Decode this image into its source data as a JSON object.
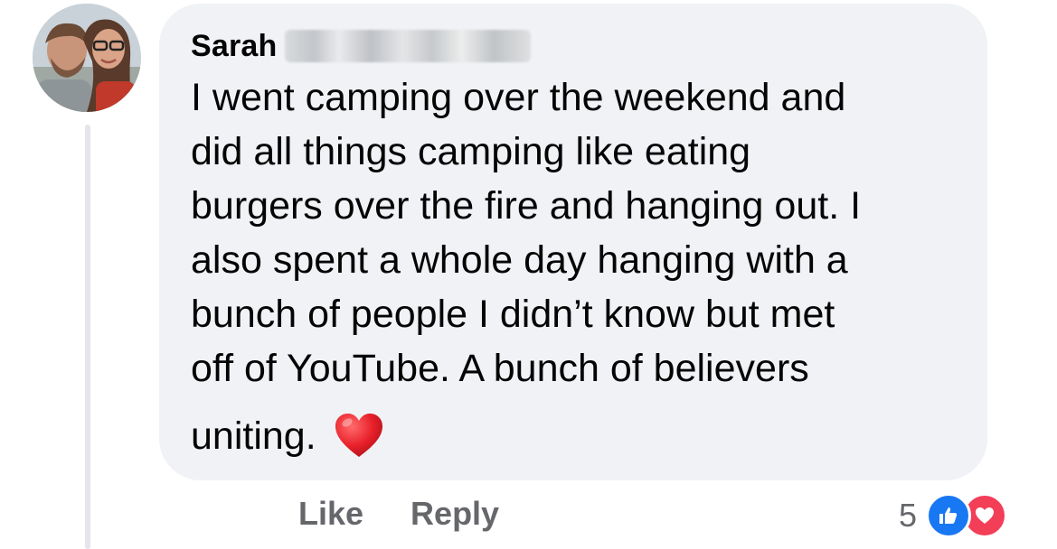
{
  "comment": {
    "author": "Sarah",
    "text_lines": [
      "I went camping over the weekend and",
      "did all things camping like eating",
      "burgers over the fire and hanging out. I",
      "also spent a whole day hanging with a",
      "bunch of people I didn’t know but met",
      "off of YouTube. A bunch of believers"
    ],
    "last_line": "uniting.",
    "emoji": "red-heart-emoji"
  },
  "actions": {
    "like_label": "Like",
    "reply_label": "Reply"
  },
  "reactions": {
    "count": "5",
    "icons": [
      "thumbs-up-icon",
      "heart-icon"
    ]
  },
  "colors": {
    "bubble": "#f0f2f5",
    "text": "#050505",
    "muted": "#65676b",
    "like_blue": "#1877f2",
    "love_red": "#f33e58"
  }
}
